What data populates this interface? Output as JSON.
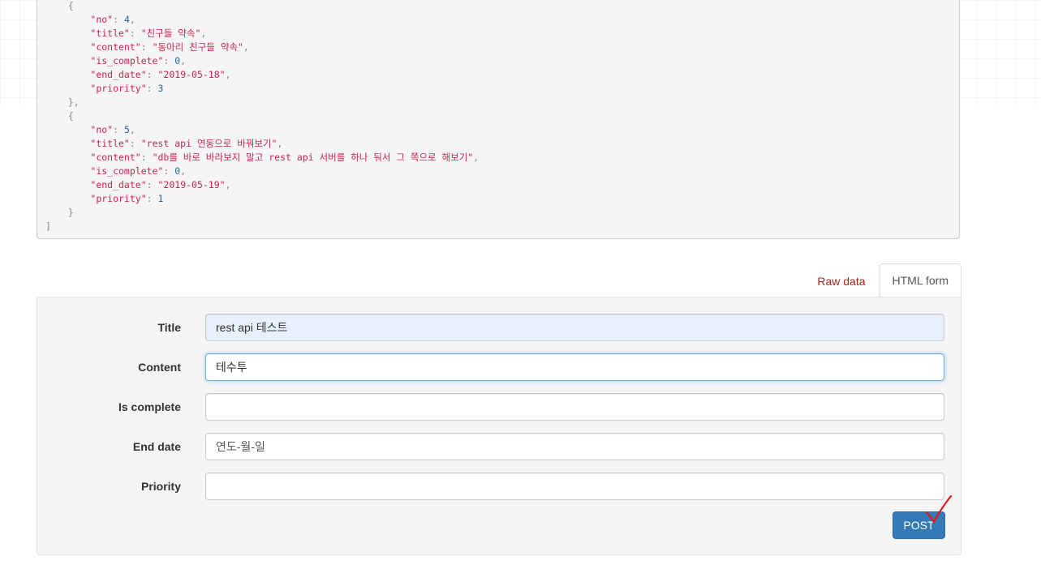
{
  "response": {
    "lines": [
      [
        [
          "p",
          "    {"
        ]
      ],
      [
        [
          "p",
          "        "
        ],
        [
          "k",
          "\"no\""
        ],
        [
          "p",
          ": "
        ],
        [
          "n",
          "4"
        ],
        [
          "p",
          ","
        ]
      ],
      [
        [
          "p",
          "        "
        ],
        [
          "k",
          "\"title\""
        ],
        [
          "p",
          ": "
        ],
        [
          "s",
          "\"친구들 약속\""
        ],
        [
          "p",
          ","
        ]
      ],
      [
        [
          "p",
          "        "
        ],
        [
          "k",
          "\"content\""
        ],
        [
          "p",
          ": "
        ],
        [
          "s",
          "\"동아리 친구들 약속\""
        ],
        [
          "p",
          ","
        ]
      ],
      [
        [
          "p",
          "        "
        ],
        [
          "k",
          "\"is_complete\""
        ],
        [
          "p",
          ": "
        ],
        [
          "n",
          "0"
        ],
        [
          "p",
          ","
        ]
      ],
      [
        [
          "p",
          "        "
        ],
        [
          "k",
          "\"end_date\""
        ],
        [
          "p",
          ": "
        ],
        [
          "s",
          "\"2019-05-18\""
        ],
        [
          "p",
          ","
        ]
      ],
      [
        [
          "p",
          "        "
        ],
        [
          "k",
          "\"priority\""
        ],
        [
          "p",
          ": "
        ],
        [
          "n",
          "3"
        ]
      ],
      [
        [
          "p",
          "    },"
        ]
      ],
      [
        [
          "p",
          "    {"
        ]
      ],
      [
        [
          "p",
          "        "
        ],
        [
          "k",
          "\"no\""
        ],
        [
          "p",
          ": "
        ],
        [
          "n",
          "5"
        ],
        [
          "p",
          ","
        ]
      ],
      [
        [
          "p",
          "        "
        ],
        [
          "k",
          "\"title\""
        ],
        [
          "p",
          ": "
        ],
        [
          "s",
          "\"rest api 연동으로 바꿔보기\""
        ],
        [
          "p",
          ","
        ]
      ],
      [
        [
          "p",
          "        "
        ],
        [
          "k",
          "\"content\""
        ],
        [
          "p",
          ": "
        ],
        [
          "s",
          "\"db를 바로 바라보지 말고 rest api 서버를 하나 둬서 그 쪽으로 해보기\""
        ],
        [
          "p",
          ","
        ]
      ],
      [
        [
          "p",
          "        "
        ],
        [
          "k",
          "\"is_complete\""
        ],
        [
          "p",
          ": "
        ],
        [
          "n",
          "0"
        ],
        [
          "p",
          ","
        ]
      ],
      [
        [
          "p",
          "        "
        ],
        [
          "k",
          "\"end_date\""
        ],
        [
          "p",
          ": "
        ],
        [
          "s",
          "\"2019-05-19\""
        ],
        [
          "p",
          ","
        ]
      ],
      [
        [
          "p",
          "        "
        ],
        [
          "k",
          "\"priority\""
        ],
        [
          "p",
          ": "
        ],
        [
          "n",
          "1"
        ]
      ],
      [
        [
          "p",
          "    }"
        ]
      ],
      [
        [
          "p",
          "]"
        ]
      ]
    ]
  },
  "tabs": {
    "raw_label": "Raw data",
    "html_label": "HTML form"
  },
  "form": {
    "title_label": "Title",
    "title_value": "rest api 테스트",
    "content_label": "Content",
    "content_value": "테수투",
    "is_complete_label": "Is complete",
    "is_complete_value": "",
    "end_date_label": "End date",
    "end_date_placeholder": "연도-월-일",
    "priority_label": "Priority",
    "priority_value": "",
    "submit_label": "POST"
  },
  "colors": {
    "accent": "#337ab7",
    "link": "#a0251a",
    "annotation": "#e8141b"
  }
}
